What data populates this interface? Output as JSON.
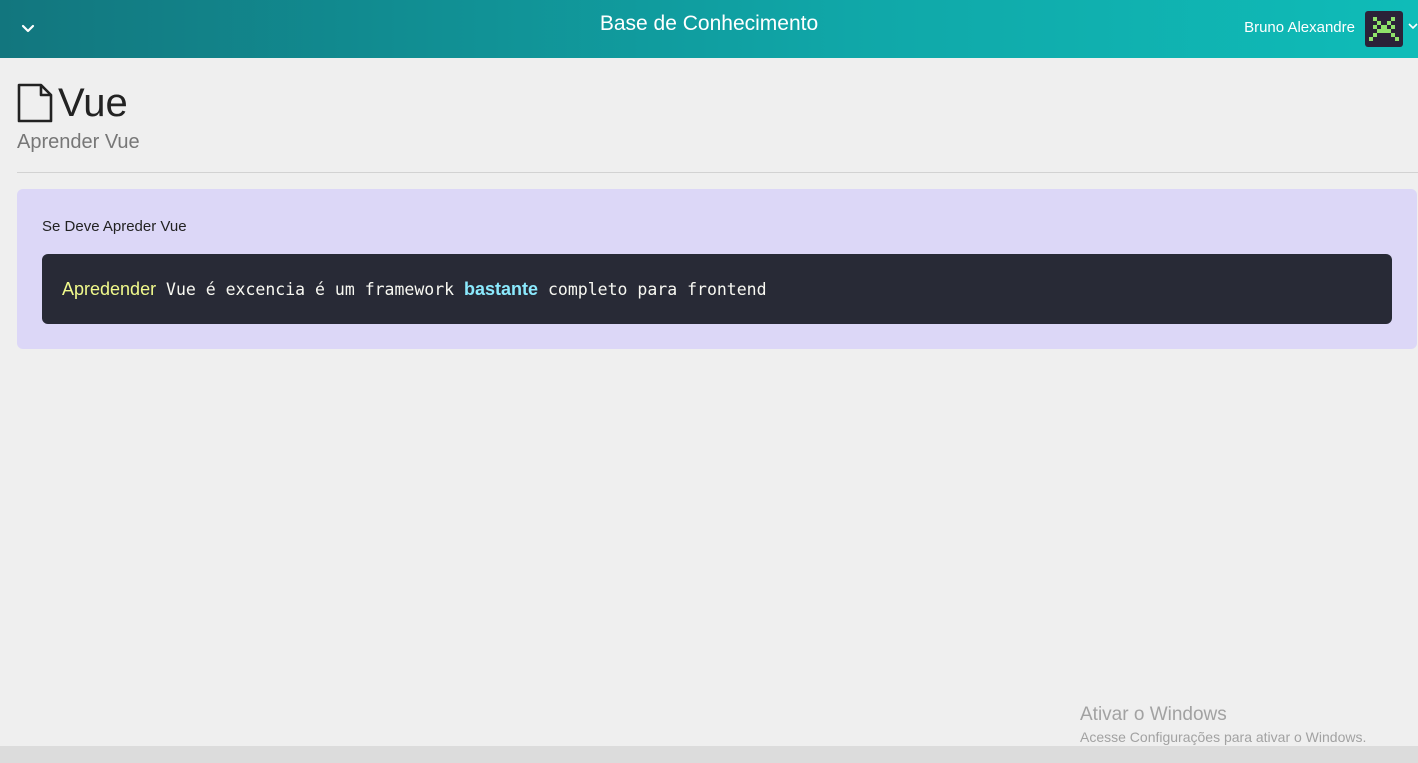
{
  "header": {
    "title": "Base de Conhecimento",
    "user_name": "Bruno Alexandre",
    "toggle_icon": "chevron-down-icon",
    "avatar": "pixel-alien-avatar",
    "gradient_start": "#12767e",
    "gradient_end": "#0fbcb8"
  },
  "article": {
    "icon": "file-icon",
    "title": "Vue",
    "subtitle": "Aprender Vue",
    "content": {
      "text": "Se Deve Apreder Vue",
      "code_parts": [
        "Apredender",
        " Vue é excencia é um framework ",
        "bastante",
        " completo para frontend"
      ]
    },
    "card_color": "#dcd7f7",
    "code_bg": "#282a36"
  },
  "watermark": {
    "title": "Ativar o Windows",
    "subtitle": "Acesse Configurações para ativar o Windows."
  }
}
